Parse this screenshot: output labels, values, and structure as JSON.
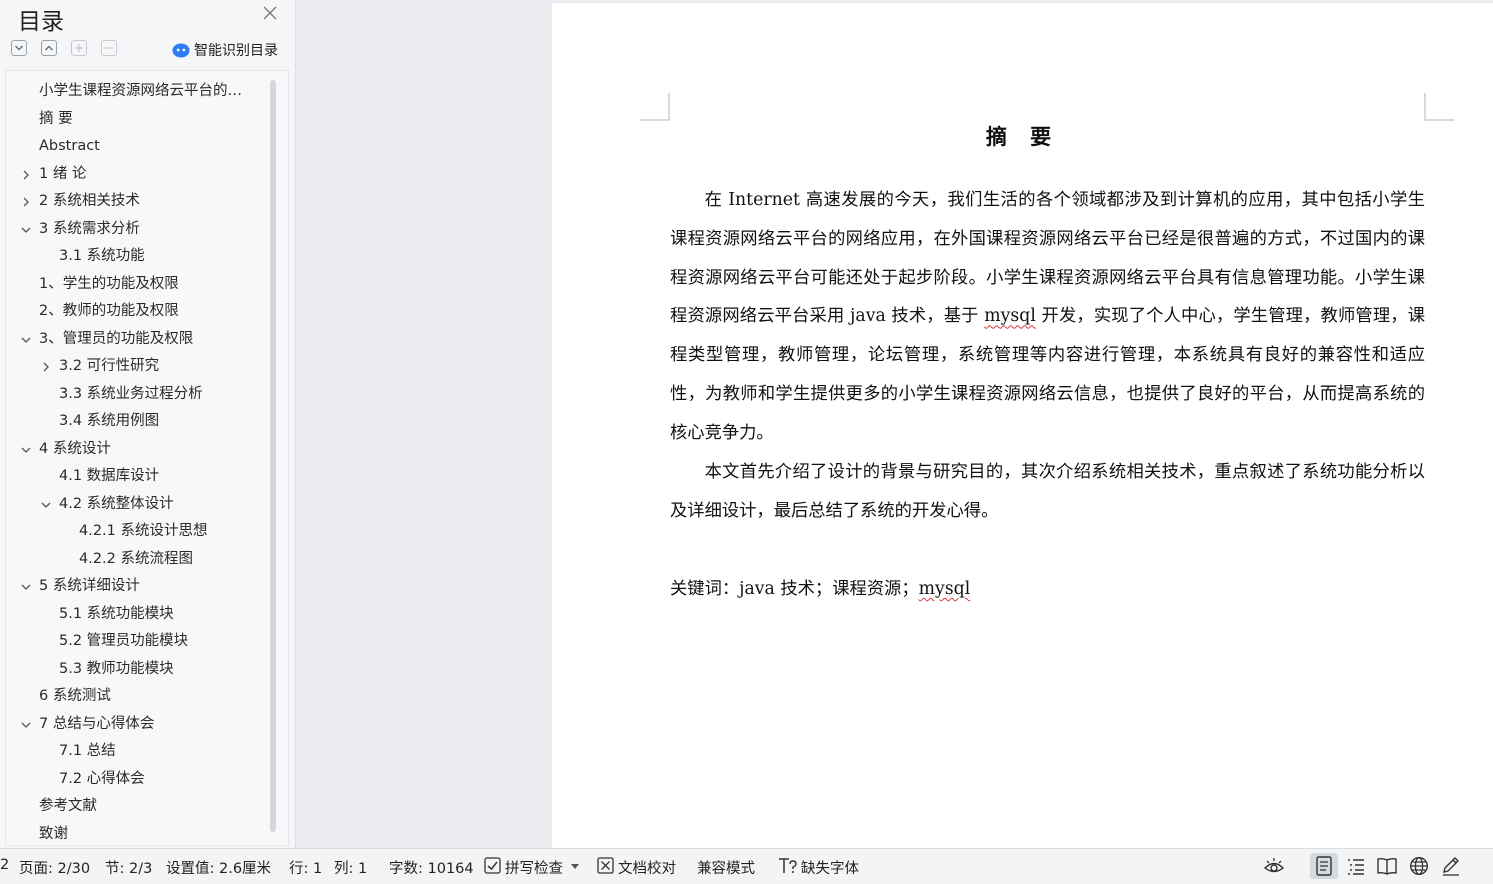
{
  "sidebar": {
    "title": "目录",
    "smart_toc": "智能识别目录",
    "toc": [
      {
        "label": "小学生课程资源网络云平台的…",
        "level": 0,
        "arrow": "none"
      },
      {
        "label": "摘  要",
        "level": 0,
        "arrow": "none"
      },
      {
        "label": "Abstract",
        "level": 0,
        "arrow": "none"
      },
      {
        "label": "1 绪  论",
        "level": 0,
        "arrow": "right"
      },
      {
        "label": "2 系统相关技术",
        "level": 0,
        "arrow": "right"
      },
      {
        "label": "3 系统需求分析",
        "level": 0,
        "arrow": "down"
      },
      {
        "label": "3.1 系统功能",
        "level": 1,
        "arrow": "none"
      },
      {
        "label": "1、学生的功能及权限",
        "level": 0,
        "arrow": "none"
      },
      {
        "label": "2、教师的功能及权限",
        "level": 0,
        "arrow": "none"
      },
      {
        "label": "3、管理员的功能及权限",
        "level": 0,
        "arrow": "down"
      },
      {
        "label": "3.2 可行性研究",
        "level": 1,
        "arrow": "right"
      },
      {
        "label": "3.3 系统业务过程分析",
        "level": 1,
        "arrow": "none"
      },
      {
        "label": "3.4 系统用例图",
        "level": 1,
        "arrow": "none"
      },
      {
        "label": "4 系统设计",
        "level": 0,
        "arrow": "down"
      },
      {
        "label": "4.1 数据库设计",
        "level": 1,
        "arrow": "none"
      },
      {
        "label": "4.2 系统整体设计",
        "level": 1,
        "arrow": "down"
      },
      {
        "label": "4.2.1  系统设计思想",
        "level": 2,
        "arrow": "none"
      },
      {
        "label": "4.2.2 系统流程图",
        "level": 2,
        "arrow": "none"
      },
      {
        "label": "5 系统详细设计",
        "level": 0,
        "arrow": "down"
      },
      {
        "label": "5.1 系统功能模块",
        "level": 1,
        "arrow": "none"
      },
      {
        "label": "5.2 管理员功能模块",
        "level": 1,
        "arrow": "none"
      },
      {
        "label": "5.3 教师功能模块",
        "level": 1,
        "arrow": "none"
      },
      {
        "label": "6 系统测试",
        "level": 0,
        "arrow": "none"
      },
      {
        "label": "7 总结与心得体会",
        "level": 0,
        "arrow": "down"
      },
      {
        "label": "7.1  总结",
        "level": 1,
        "arrow": "none"
      },
      {
        "label": "7.2  心得体会",
        "level": 1,
        "arrow": "none"
      },
      {
        "label": "参考文献",
        "level": 0,
        "arrow": "none"
      },
      {
        "label": "致谢",
        "level": 0,
        "arrow": "none"
      }
    ]
  },
  "document": {
    "heading": "摘 要",
    "para1": "在 Internet 高速发展的今天，我们生活的各个领域都涉及到计算机的应用，其中包括小学生课程资源网络云平台的网络应用，在外国课程资源网络云平台已经是很普遍的方式，不过国内的课程资源网络云平台可能还处于起步阶段。小学生课程资源网络云平台具有信息管理功能。小学生课程资源网络云平台采用 java 技术，基于 mysql 开发，实现了个人中心，学生管理，教师管理，课程类型管理，教师管理，论坛管理，系统管理等内容进行管理，本系统具有良好的兼容性和适应性，为教师和学生提供更多的小学生课程资源网络云信息，也提供了良好的平台，从而提高系统的核心竞争力。",
    "para1_a": "在 Internet 高速发展的今天，我们生活的各个领域都涉及到计算机的应用，其中包括小学生课程资源网络云平台的网络应用，在外国课程资源网络云平台已经是很普遍的方式，不过国内的课程资源网络云平台可能还处于起步阶段。小学生课程资源网络云平台具有信息管理功能。小学生课程资源网络云平台采用 java 技术，基于 ",
    "para1_word": "mysql",
    "para1_b": " 开发，实现了个人中心，学生管理，教师管理，课程类型管理，教师管理，论坛管理，系统管理等内容进行管理，本系统具有良好的兼容性和适应性，为教师和学生提供更多的小学生课程资源网络云信息，也提供了良好的平台，从而提高系统的核心竞争力。",
    "para2": "本文首先介绍了设计的背景与研究目的，其次介绍系统相关技术，重点叙述了系统功能分析以及详细设计，最后总结了系统的开发心得。",
    "keywords_a": "关键词：java 技术；课程资源；",
    "keywords_word": "mysql"
  },
  "statusbar": {
    "edge_digit": "2",
    "page": "页面: 2/30",
    "section": "节: 2/3",
    "setting": "设置值: 2.6厘米",
    "row": "行: 1",
    "col": "列: 1",
    "word_count": "字数: 10164",
    "spell_check": "拼写检查",
    "doc_proof": "文档校对",
    "compat_mode": "兼容模式",
    "missing_fonts": "缺失字体"
  },
  "icons": [
    "close-icon",
    "collapse-all-icon",
    "expand-all-icon",
    "add-level-icon",
    "remove-level-icon",
    "ai-cloud-icon",
    "eye-protect-icon",
    "page-view-icon",
    "outline-view-icon",
    "reading-view-icon",
    "web-view-icon",
    "pen-icon"
  ],
  "colors": {
    "accent": "#2f7bf5",
    "squiggle": "#d23a3a"
  }
}
